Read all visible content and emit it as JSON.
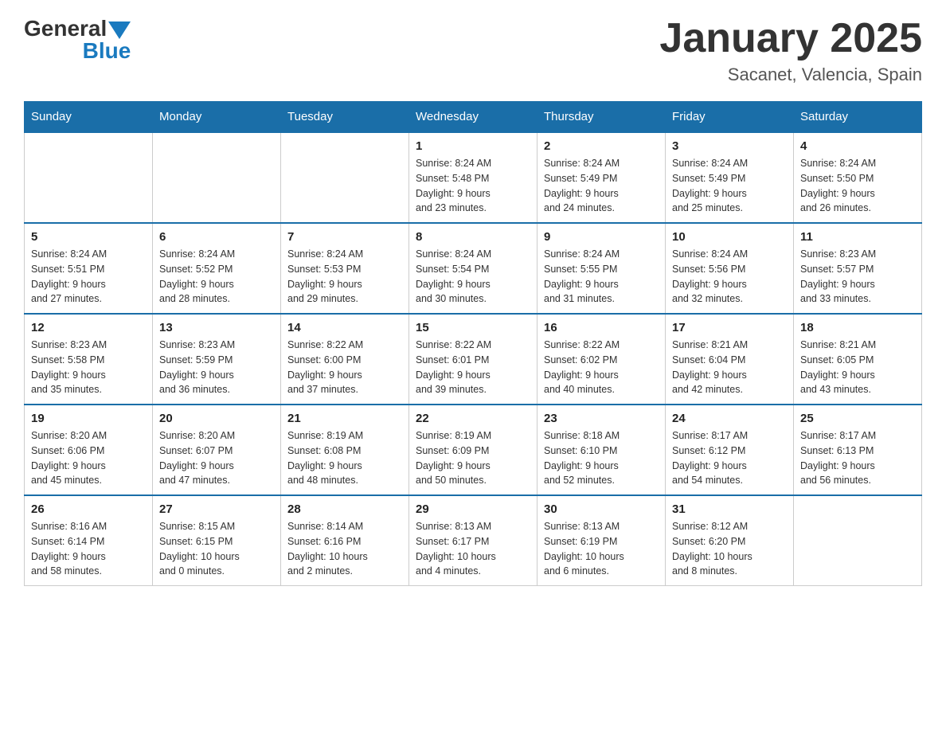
{
  "logo": {
    "text_general": "General",
    "text_blue": "Blue"
  },
  "title": "January 2025",
  "subtitle": "Sacanet, Valencia, Spain",
  "headers": [
    "Sunday",
    "Monday",
    "Tuesday",
    "Wednesday",
    "Thursday",
    "Friday",
    "Saturday"
  ],
  "weeks": [
    [
      {
        "day": "",
        "info": ""
      },
      {
        "day": "",
        "info": ""
      },
      {
        "day": "",
        "info": ""
      },
      {
        "day": "1",
        "info": "Sunrise: 8:24 AM\nSunset: 5:48 PM\nDaylight: 9 hours\nand 23 minutes."
      },
      {
        "day": "2",
        "info": "Sunrise: 8:24 AM\nSunset: 5:49 PM\nDaylight: 9 hours\nand 24 minutes."
      },
      {
        "day": "3",
        "info": "Sunrise: 8:24 AM\nSunset: 5:49 PM\nDaylight: 9 hours\nand 25 minutes."
      },
      {
        "day": "4",
        "info": "Sunrise: 8:24 AM\nSunset: 5:50 PM\nDaylight: 9 hours\nand 26 minutes."
      }
    ],
    [
      {
        "day": "5",
        "info": "Sunrise: 8:24 AM\nSunset: 5:51 PM\nDaylight: 9 hours\nand 27 minutes."
      },
      {
        "day": "6",
        "info": "Sunrise: 8:24 AM\nSunset: 5:52 PM\nDaylight: 9 hours\nand 28 minutes."
      },
      {
        "day": "7",
        "info": "Sunrise: 8:24 AM\nSunset: 5:53 PM\nDaylight: 9 hours\nand 29 minutes."
      },
      {
        "day": "8",
        "info": "Sunrise: 8:24 AM\nSunset: 5:54 PM\nDaylight: 9 hours\nand 30 minutes."
      },
      {
        "day": "9",
        "info": "Sunrise: 8:24 AM\nSunset: 5:55 PM\nDaylight: 9 hours\nand 31 minutes."
      },
      {
        "day": "10",
        "info": "Sunrise: 8:24 AM\nSunset: 5:56 PM\nDaylight: 9 hours\nand 32 minutes."
      },
      {
        "day": "11",
        "info": "Sunrise: 8:23 AM\nSunset: 5:57 PM\nDaylight: 9 hours\nand 33 minutes."
      }
    ],
    [
      {
        "day": "12",
        "info": "Sunrise: 8:23 AM\nSunset: 5:58 PM\nDaylight: 9 hours\nand 35 minutes."
      },
      {
        "day": "13",
        "info": "Sunrise: 8:23 AM\nSunset: 5:59 PM\nDaylight: 9 hours\nand 36 minutes."
      },
      {
        "day": "14",
        "info": "Sunrise: 8:22 AM\nSunset: 6:00 PM\nDaylight: 9 hours\nand 37 minutes."
      },
      {
        "day": "15",
        "info": "Sunrise: 8:22 AM\nSunset: 6:01 PM\nDaylight: 9 hours\nand 39 minutes."
      },
      {
        "day": "16",
        "info": "Sunrise: 8:22 AM\nSunset: 6:02 PM\nDaylight: 9 hours\nand 40 minutes."
      },
      {
        "day": "17",
        "info": "Sunrise: 8:21 AM\nSunset: 6:04 PM\nDaylight: 9 hours\nand 42 minutes."
      },
      {
        "day": "18",
        "info": "Sunrise: 8:21 AM\nSunset: 6:05 PM\nDaylight: 9 hours\nand 43 minutes."
      }
    ],
    [
      {
        "day": "19",
        "info": "Sunrise: 8:20 AM\nSunset: 6:06 PM\nDaylight: 9 hours\nand 45 minutes."
      },
      {
        "day": "20",
        "info": "Sunrise: 8:20 AM\nSunset: 6:07 PM\nDaylight: 9 hours\nand 47 minutes."
      },
      {
        "day": "21",
        "info": "Sunrise: 8:19 AM\nSunset: 6:08 PM\nDaylight: 9 hours\nand 48 minutes."
      },
      {
        "day": "22",
        "info": "Sunrise: 8:19 AM\nSunset: 6:09 PM\nDaylight: 9 hours\nand 50 minutes."
      },
      {
        "day": "23",
        "info": "Sunrise: 8:18 AM\nSunset: 6:10 PM\nDaylight: 9 hours\nand 52 minutes."
      },
      {
        "day": "24",
        "info": "Sunrise: 8:17 AM\nSunset: 6:12 PM\nDaylight: 9 hours\nand 54 minutes."
      },
      {
        "day": "25",
        "info": "Sunrise: 8:17 AM\nSunset: 6:13 PM\nDaylight: 9 hours\nand 56 minutes."
      }
    ],
    [
      {
        "day": "26",
        "info": "Sunrise: 8:16 AM\nSunset: 6:14 PM\nDaylight: 9 hours\nand 58 minutes."
      },
      {
        "day": "27",
        "info": "Sunrise: 8:15 AM\nSunset: 6:15 PM\nDaylight: 10 hours\nand 0 minutes."
      },
      {
        "day": "28",
        "info": "Sunrise: 8:14 AM\nSunset: 6:16 PM\nDaylight: 10 hours\nand 2 minutes."
      },
      {
        "day": "29",
        "info": "Sunrise: 8:13 AM\nSunset: 6:17 PM\nDaylight: 10 hours\nand 4 minutes."
      },
      {
        "day": "30",
        "info": "Sunrise: 8:13 AM\nSunset: 6:19 PM\nDaylight: 10 hours\nand 6 minutes."
      },
      {
        "day": "31",
        "info": "Sunrise: 8:12 AM\nSunset: 6:20 PM\nDaylight: 10 hours\nand 8 minutes."
      },
      {
        "day": "",
        "info": ""
      }
    ]
  ]
}
